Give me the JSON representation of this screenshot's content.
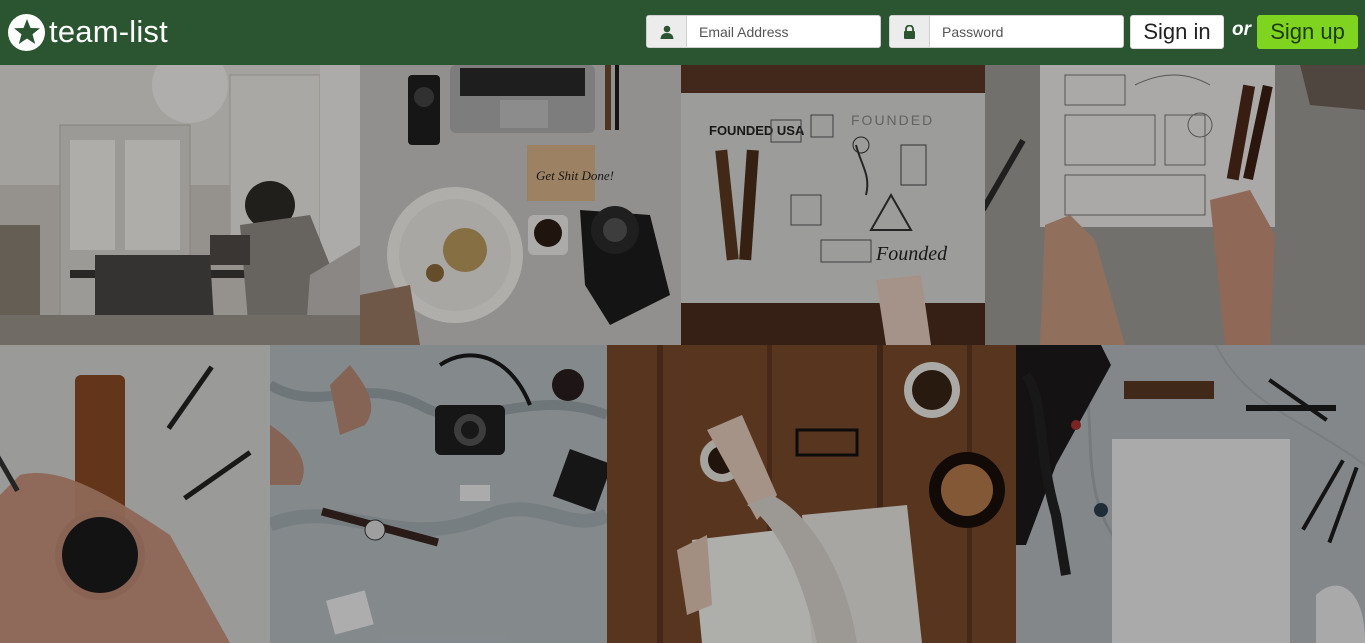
{
  "header": {
    "brand_name": "team-list",
    "brand_icon": "star-icon",
    "email_placeholder": "Email Address",
    "password_placeholder": "Password",
    "email_icon": "user-icon",
    "password_icon": "lock-icon",
    "signin_label": "Sign in",
    "or_label": "or",
    "signup_label": "Sign up"
  },
  "colors": {
    "header_bg": "#2a5530",
    "signup_bg": "#7fd41f"
  },
  "gallery": {
    "photos": [
      {
        "subject": "office-desk-photo"
      },
      {
        "subject": "breakfast-camera-photo"
      },
      {
        "subject": "founded-usa-sketches-photo"
      },
      {
        "subject": "architectural-drawing-photo"
      },
      {
        "subject": "wristwatch-photo"
      },
      {
        "subject": "map-camera-photo"
      },
      {
        "subject": "coffee-notebook-photo"
      },
      {
        "subject": "marble-desk-notepad-photo"
      }
    ]
  }
}
